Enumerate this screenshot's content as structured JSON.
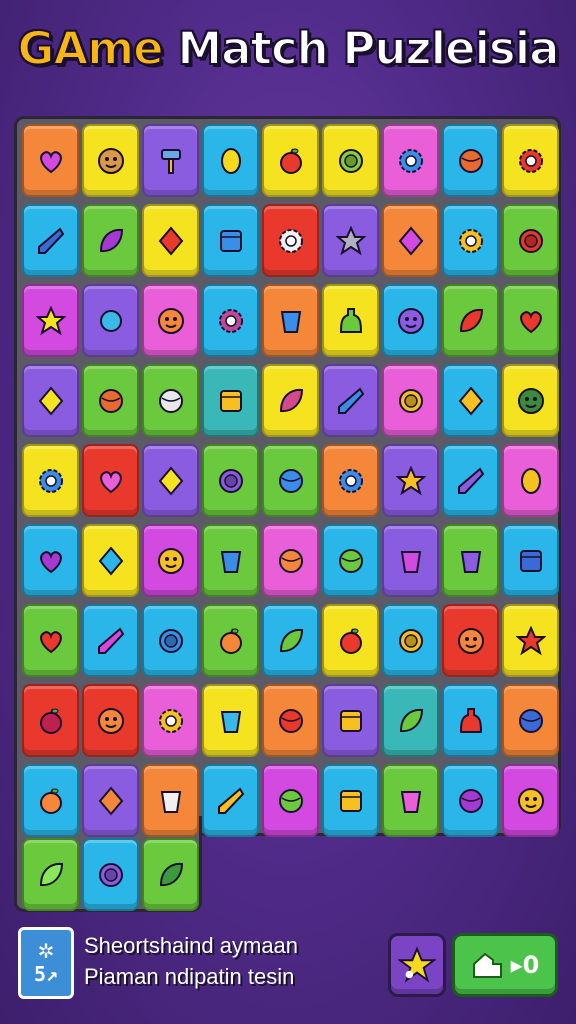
{
  "header": {
    "title_part1": "GAme",
    "title_part2": " Match Puzleisia"
  },
  "board": {
    "rows": [
      [
        {
          "c": "#f5873a",
          "i": "heart",
          "ic": "#d24adf"
        },
        {
          "c": "#f5e320",
          "i": "face",
          "ic": "#d99a48"
        },
        {
          "c": "#8a5ce0",
          "i": "hammer",
          "ic": "#6aa8e8"
        },
        {
          "c": "#2ab6e8",
          "i": "lemon",
          "ic": "#f5d820"
        },
        {
          "c": "#f5e320",
          "i": "apple",
          "ic": "#e8392c"
        },
        {
          "c": "#f5e320",
          "i": "ring",
          "ic": "#8ad03c"
        },
        {
          "c": "#e85fd8",
          "i": "gear",
          "ic": "#3a8ee8"
        },
        {
          "c": "#2ab6e8",
          "i": "ball",
          "ic": "#e86a30"
        },
        {
          "c": "#f5e320",
          "i": "gear",
          "ic": "#e8392c"
        }
      ],
      [
        {
          "c": "#2ab6e8",
          "i": "shard",
          "ic": "#3c6ad6"
        },
        {
          "c": "#6ac93c",
          "i": "leaf",
          "ic": "#a43ad0"
        },
        {
          "c": "#f5e320",
          "i": "diamond",
          "ic": "#e8392c"
        },
        {
          "c": "#2ab6e8",
          "i": "box",
          "ic": "#3a8ee8"
        },
        {
          "c": "#e8392c",
          "i": "gear",
          "ic": "#f0f0f0"
        },
        {
          "c": "#8a5ce0",
          "i": "star",
          "ic": "#b0b0c0"
        },
        {
          "c": "#f5873a",
          "i": "diamond",
          "ic": "#d24adf"
        },
        {
          "c": "#2ab6e8",
          "i": "gear",
          "ic": "#f5c020"
        },
        {
          "c": "#6ac93c",
          "i": "ring",
          "ic": "#e8392c"
        }
      ],
      [
        {
          "c": "#d24adf",
          "i": "star",
          "ic": "#f5e320"
        },
        {
          "c": "#8a5ce0",
          "i": "drop",
          "ic": "#3ab8e8"
        },
        {
          "c": "#e85fd8",
          "i": "face",
          "ic": "#f5873a"
        },
        {
          "c": "#2ab6e8",
          "i": "gear",
          "ic": "#c04a9a"
        },
        {
          "c": "#f5873a",
          "i": "cup",
          "ic": "#3a8ee8"
        },
        {
          "c": "#f5e320",
          "i": "bottle",
          "ic": "#6ac93c"
        },
        {
          "c": "#2ab6e8",
          "i": "face",
          "ic": "#8a5ce0"
        },
        {
          "c": "#6ac93c",
          "i": "leaf",
          "ic": "#e8392c"
        },
        {
          "c": "#6ac93c",
          "i": "heart",
          "ic": "#e8392c"
        }
      ],
      [
        {
          "c": "#8a5ce0",
          "i": "diamond",
          "ic": "#f5e320"
        },
        {
          "c": "#6ac93c",
          "i": "ball",
          "ic": "#e86a30"
        },
        {
          "c": "#6ac93c",
          "i": "ball",
          "ic": "#e8e8e8"
        },
        {
          "c": "#3ab8b8",
          "i": "box",
          "ic": "#f5c020"
        },
        {
          "c": "#f5e320",
          "i": "leaf",
          "ic": "#d24a8a"
        },
        {
          "c": "#8a5ce0",
          "i": "shard",
          "ic": "#3a8ee8"
        },
        {
          "c": "#e85fd8",
          "i": "ring",
          "ic": "#f5c020"
        },
        {
          "c": "#2ab6e8",
          "i": "diamond",
          "ic": "#f5c020"
        },
        {
          "c": "#f5e320",
          "i": "face",
          "ic": "#3c8a3c"
        }
      ],
      [
        {
          "c": "#f5e320",
          "i": "gear",
          "ic": "#3a8ee8"
        },
        {
          "c": "#e8392c",
          "i": "heart",
          "ic": "#e85fd8"
        },
        {
          "c": "#8a5ce0",
          "i": "diamond",
          "ic": "#f5e320"
        },
        {
          "c": "#6ac93c",
          "i": "ring",
          "ic": "#8a5ce0"
        },
        {
          "c": "#6ac93c",
          "i": "ball",
          "ic": "#3a8ee8"
        },
        {
          "c": "#f5873a",
          "i": "gear",
          "ic": "#3a8ee8"
        },
        {
          "c": "#8a5ce0",
          "i": "star",
          "ic": "#f5c020"
        },
        {
          "c": "#2ab6e8",
          "i": "shard",
          "ic": "#8a5ce0"
        },
        {
          "c": "#e85fd8",
          "i": "lemon",
          "ic": "#f5c020"
        }
      ],
      [
        {
          "c": "#2ab6e8",
          "i": "heart",
          "ic": "#a43ad0"
        },
        {
          "c": "#f5e320",
          "i": "diamond",
          "ic": "#2ab6e8"
        },
        {
          "c": "#d24adf",
          "i": "face",
          "ic": "#f5c020"
        },
        {
          "c": "#6ac93c",
          "i": "cup",
          "ic": "#3a8ee8"
        },
        {
          "c": "#e85fd8",
          "i": "ball",
          "ic": "#f5873a"
        },
        {
          "c": "#2ab6e8",
          "i": "ball",
          "ic": "#6ac93c"
        },
        {
          "c": "#8a5ce0",
          "i": "cup",
          "ic": "#d24adf"
        },
        {
          "c": "#6ac93c",
          "i": "cup",
          "ic": "#8a5ce0"
        },
        {
          "c": "#2ab6e8",
          "i": "box",
          "ic": "#3a6ad6"
        }
      ],
      [
        {
          "c": "#6ac93c",
          "i": "heart",
          "ic": "#e8392c"
        },
        {
          "c": "#2ab6e8",
          "i": "shard",
          "ic": "#d24adf"
        },
        {
          "c": "#2ab6e8",
          "i": "ring",
          "ic": "#3a8ee8"
        },
        {
          "c": "#6ac93c",
          "i": "apple",
          "ic": "#f5873a"
        },
        {
          "c": "#2ab6e8",
          "i": "leaf",
          "ic": "#6ac93c"
        },
        {
          "c": "#f5e320",
          "i": "apple",
          "ic": "#e8392c"
        },
        {
          "c": "#2ab6e8",
          "i": "ring",
          "ic": "#f5c020"
        },
        {
          "c": "#e8392c",
          "i": "face",
          "ic": "#f5873a"
        },
        {
          "c": "#f5e320",
          "i": "star",
          "ic": "#e8392c"
        }
      ],
      [
        {
          "c": "#e8392c",
          "i": "apple",
          "ic": "#c02050"
        },
        {
          "c": "#e8392c",
          "i": "face",
          "ic": "#f5873a"
        },
        {
          "c": "#e85fd8",
          "i": "gear",
          "ic": "#f5c020"
        },
        {
          "c": "#f5e320",
          "i": "cup",
          "ic": "#3ab8e8"
        },
        {
          "c": "#f5873a",
          "i": "ball",
          "ic": "#e8392c"
        },
        {
          "c": "#8a5ce0",
          "i": "box",
          "ic": "#f5c020"
        },
        {
          "c": "#3ab8b8",
          "i": "leaf",
          "ic": "#6ac93c"
        },
        {
          "c": "#2ab6e8",
          "i": "bottle",
          "ic": "#e8392c"
        },
        {
          "c": "#f5873a",
          "i": "ball",
          "ic": "#3a6ad6"
        }
      ],
      [
        {
          "c": "#2ab6e8",
          "i": "apple",
          "ic": "#f5873a"
        },
        {
          "c": "#8a5ce0",
          "i": "diamond",
          "ic": "#f5873a"
        },
        {
          "c": "#f5873a",
          "i": "cup",
          "ic": "#f0f0f0"
        },
        {
          "c": "#2ab6e8",
          "i": "shard",
          "ic": "#f5c020"
        },
        {
          "c": "#d24adf",
          "i": "ball",
          "ic": "#6ac93c"
        },
        {
          "c": "#2ab6e8",
          "i": "box",
          "ic": "#f5c020"
        },
        {
          "c": "#6ac93c",
          "i": "cup",
          "ic": "#e85fd8"
        },
        {
          "c": "#2ab6e8",
          "i": "ball",
          "ic": "#a43ad0"
        },
        {
          "c": "#d24adf",
          "i": "face",
          "ic": "#f5c020"
        }
      ],
      [
        {
          "c": "#6ac93c",
          "i": "leaf",
          "ic": "#8ae85a"
        },
        {
          "c": "#2ab6e8",
          "i": "ring",
          "ic": "#8a5ce0"
        },
        {
          "c": "#6ac93c",
          "i": "leaf",
          "ic": "#3c9a3c"
        }
      ]
    ]
  },
  "footer": {
    "badge_icon": "puzzle-icon",
    "badge_number": "5↗",
    "line1": "Sheortshaind aymaan",
    "line2": "Piaman ndipatin tesin",
    "hint_button_icon": "star-icon",
    "play_button_icon": "hand-icon",
    "play_button_label": "▸0"
  }
}
